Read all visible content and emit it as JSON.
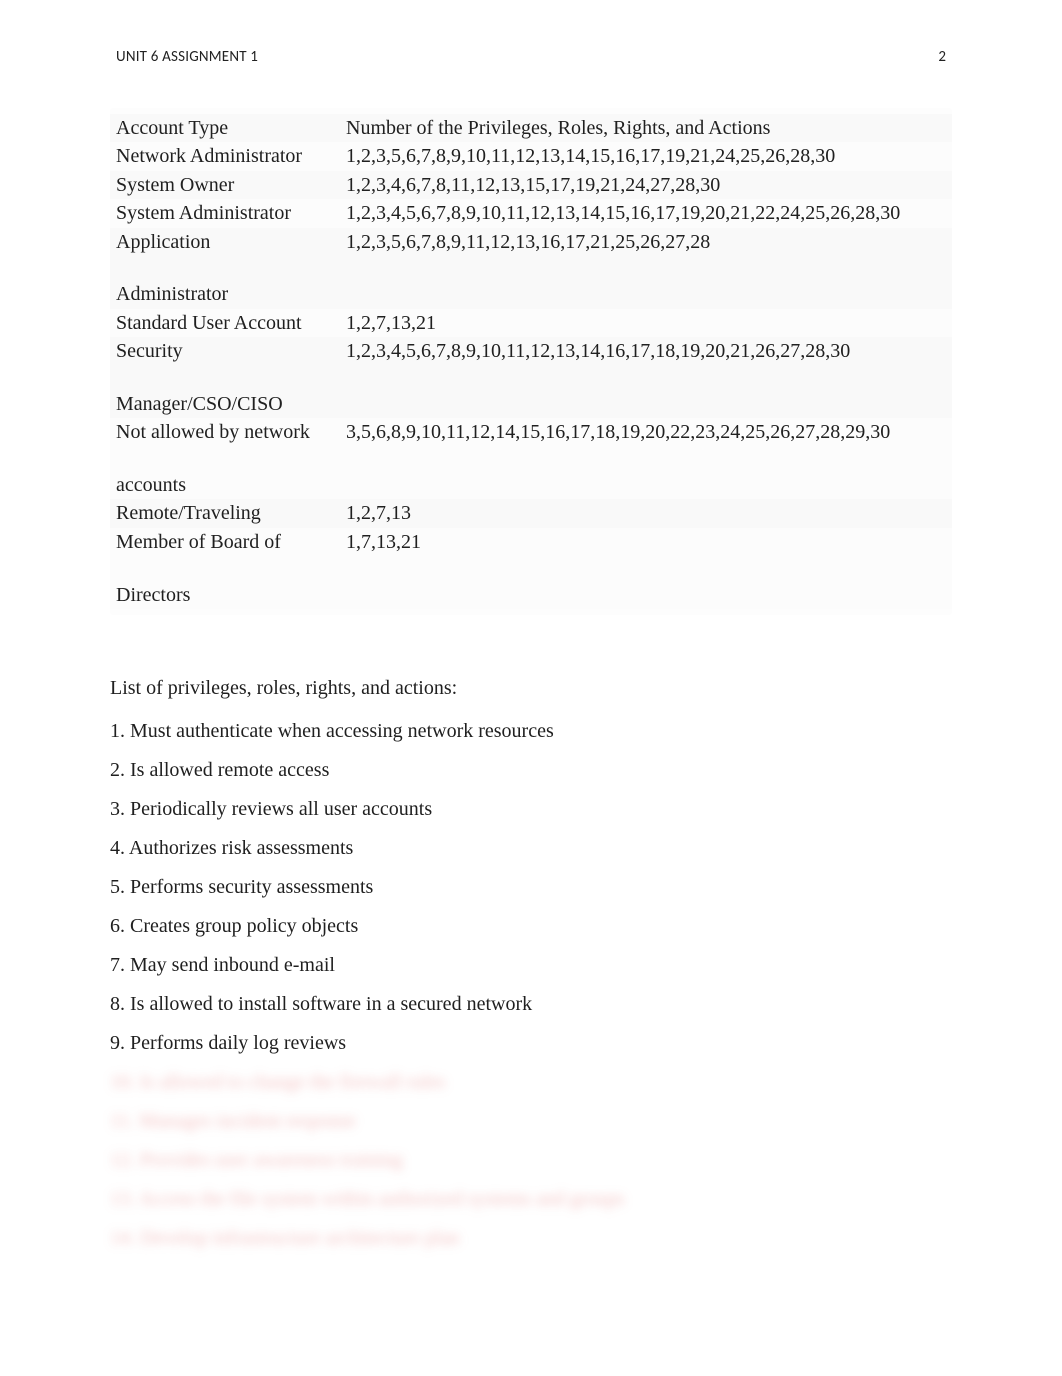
{
  "header": {
    "title": "UNIT 6 ASSIGNMENT 1",
    "page_number": "2"
  },
  "table": {
    "rows": [
      {
        "label": "Account Type",
        "value": "Number of the Privileges, Roles, Rights, and Actions"
      },
      {
        "label": "Network Administrator",
        "value": "1,2,3,5,6,7,8,9,10,11,12,13,14,15,16,17,19,21,24,25,26,28,30"
      },
      {
        "label": "System Owner",
        "value": "1,2,3,4,6,7,8,11,12,13,15,17,19,21,24,27,28,30"
      },
      {
        "label": "System Administrator",
        "value": "1,2,3,4,5,6,7,8,9,10,11,12,13,14,15,16,17,19,20,21,22,24,25,26,28,30"
      },
      {
        "label": "Application\n\nAdministrator",
        "value": "1,2,3,5,6,7,8,9,11,12,13,16,17,21,25,26,27,28"
      },
      {
        "label": "Standard User Account",
        "value": "1,2,7,13,21"
      },
      {
        "label": "Security\n\nManager/CSO/CISO",
        "value": "1,2,3,4,5,6,7,8,9,10,11,12,13,14,16,17,18,19,20,21,26,27,28,30"
      },
      {
        "label": "Not allowed by network\n\naccounts",
        "value": "3,5,6,8,9,10,11,12,14,15,16,17,18,19,20,22,23,24,25,26,27,28,29,30"
      },
      {
        "label": "Remote/Traveling",
        "value": "1,2,7,13"
      },
      {
        "label": "Member of Board of\n\nDirectors",
        "value": "1,7,13,21"
      }
    ]
  },
  "list_heading": "List of privileges, roles, rights, and actions:",
  "privileges": [
    "1. Must authenticate when accessing network resources",
    "2. Is allowed remote access",
    "3. Periodically reviews all user accounts",
    "4. Authorizes risk assessments",
    "5. Performs security assessments",
    "6. Creates group policy objects",
    "7. May send inbound e-mail",
    "8. Is allowed to install software in a secured network",
    "9. Performs daily log reviews"
  ],
  "blurred_items": [
    "10. Is allowed to change the firewall rules",
    "11. Manages incident response",
    "12. Provides user awareness training",
    "13. Access the file system within authorized systems and groups",
    "14. Develop infrastructure architecture plan"
  ]
}
